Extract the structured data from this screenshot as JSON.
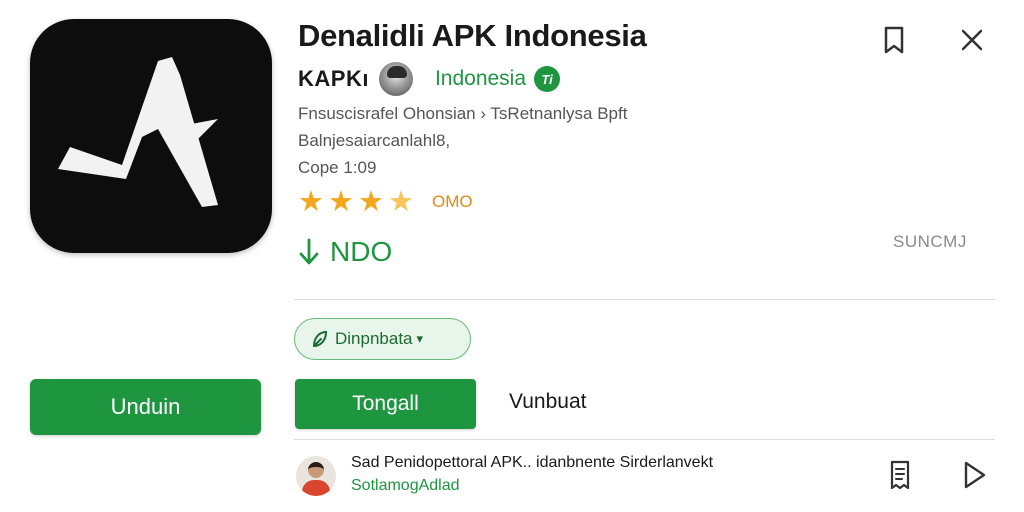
{
  "app": {
    "title": "Denalidli APK Indonesia",
    "developer": "KAPKı",
    "country": "Indonesia",
    "country_badge": "Ti",
    "category_line": "Fnsuscisrafel Ohonsian › TsRetnanlysa Bpft",
    "subtitle_line": "Balnjesaiarcanlahl8,",
    "version_line": "Cope 1:09",
    "rating_count": "OMO",
    "size": "NDO",
    "side_label": "SUNCMJ"
  },
  "chip": {
    "label": "Dinpnbata"
  },
  "buttons": {
    "download": "Unduin",
    "install": "Tongall",
    "secondary": "Vunbuat"
  },
  "related": {
    "title": "Sad Penidopettoral APK.. idanbnente Sirderlanvekt",
    "subtitle": "SotlamogAdlad"
  },
  "icons": {
    "bookmark": "bookmark-icon",
    "close": "close-icon",
    "download_arrow": "download-arrow-icon",
    "chip_leaf": "leaf-icon",
    "document": "document-icon",
    "play": "play-icon"
  },
  "colors": {
    "accent_green": "#1e9640",
    "star": "#f3a71c",
    "icon_bg": "#0d0d0d"
  },
  "rating": {
    "stars_value": 3.5,
    "stars_max": 4
  }
}
